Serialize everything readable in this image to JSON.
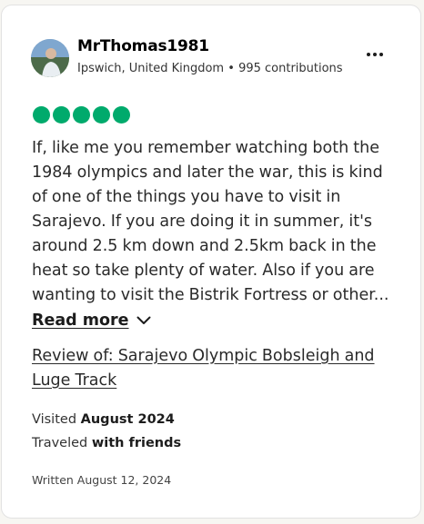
{
  "reviewer": {
    "username": "MrThomas1981",
    "location": "Ipswich, United Kingdom",
    "contributions": "995 contributions",
    "separator": "•"
  },
  "rating": {
    "value": 5,
    "max": 5,
    "color": "#00aa6c"
  },
  "review": {
    "text": "If, like me you remember watching both the 1984 olympics and later the war, this is kind of one of the things you have to visit in Sarajevo. If you are doing it in summer, it's around 2.5 km down and 2.5km back in the heat so take plenty of water. Also if you are wanting to visit the Bistrik Fortress or other...",
    "read_more_label": "Read more",
    "review_of_link": "Review of: Sarajevo Olympic Bobsleigh and Luge Track"
  },
  "trip": {
    "visited_prefix": "Visited",
    "visited_date": "August 2024",
    "traveled_prefix": "Traveled",
    "traveled_with": "with friends"
  },
  "written": "Written August 12, 2024",
  "icons": {
    "more": "more-options-icon",
    "chevron": "chevron-down-icon"
  }
}
